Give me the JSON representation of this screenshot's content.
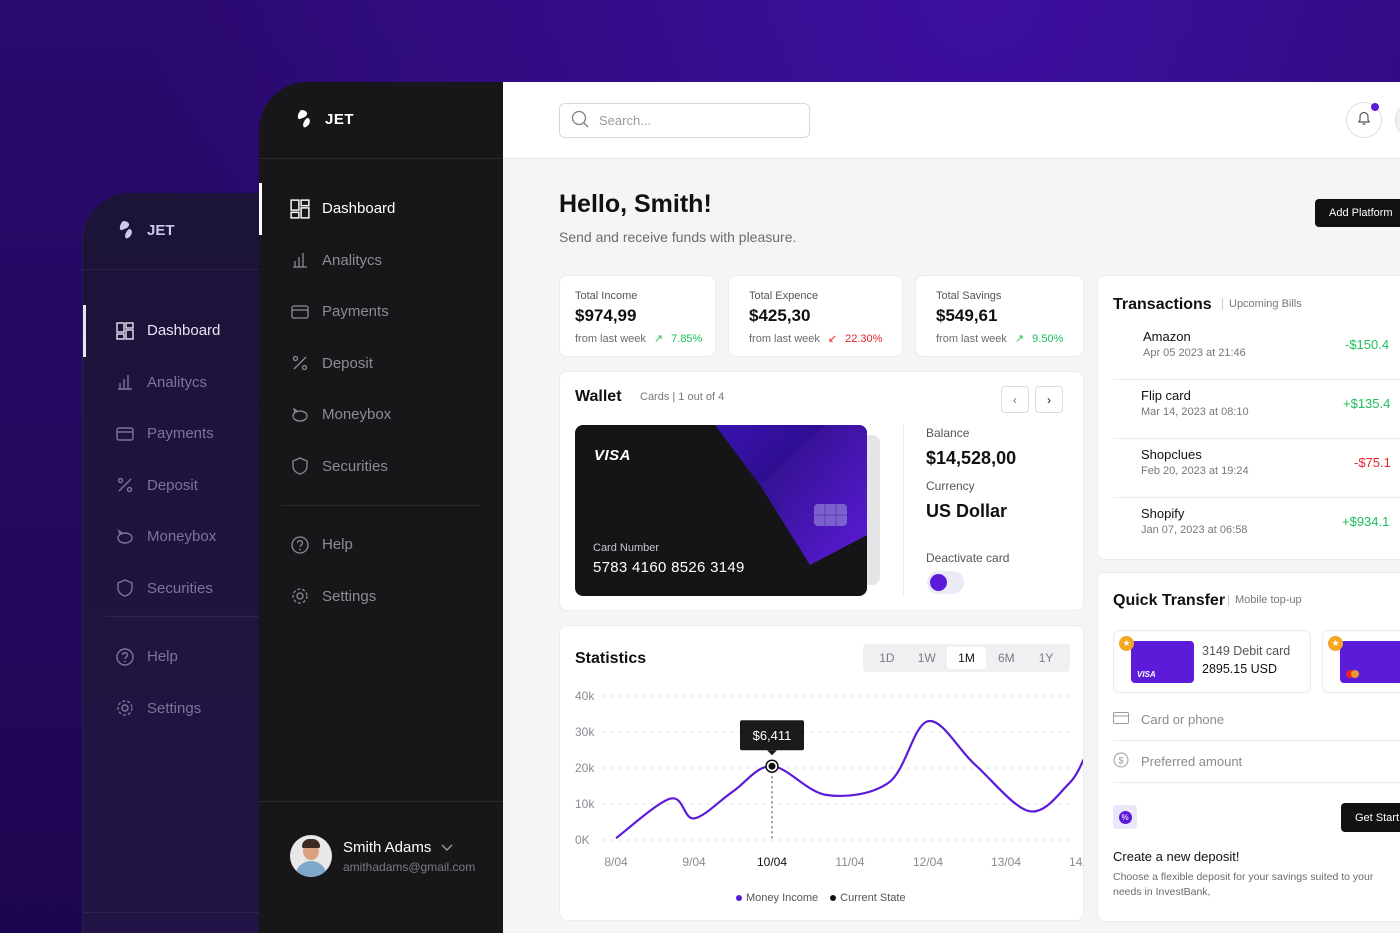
{
  "brand": {
    "name": "JET"
  },
  "sidebar": {
    "items": [
      {
        "label": "Dashboard",
        "icon": "dashboard-icon"
      },
      {
        "label": "Analitycs",
        "icon": "chart-icon"
      },
      {
        "label": "Payments",
        "icon": "wallet-icon"
      },
      {
        "label": "Deposit",
        "icon": "percent-icon"
      },
      {
        "label": "Moneybox",
        "icon": "piggy-bank-icon"
      },
      {
        "label": "Securities",
        "icon": "shield-icon"
      }
    ],
    "secondary": [
      {
        "label": "Help",
        "icon": "help-icon"
      },
      {
        "label": "Settings",
        "icon": "gear-icon"
      }
    ],
    "profile": {
      "name": "Smith Adams",
      "email": "amithadams@gmail.com"
    }
  },
  "topbar": {
    "search_placeholder": "Search..."
  },
  "header": {
    "greeting": "Hello, Smith!",
    "subtitle": "Send and receive funds with pleasure.",
    "add_button": "Add Platform"
  },
  "stats": [
    {
      "label": "Total Income",
      "value": "$974,99",
      "foot": "from last week",
      "change": "7.85%",
      "trend": "up"
    },
    {
      "label": "Total Expence",
      "value": "$425,30",
      "foot": "from last week",
      "change": "22.30%",
      "trend": "down"
    },
    {
      "label": "Total Savings",
      "value": "$549,61",
      "foot": "from last week",
      "change": "9.50%",
      "trend": "up"
    }
  ],
  "wallet": {
    "title": "Wallet",
    "cards_label": "Cards | 1 out of 4",
    "card_brand": "VISA",
    "card_number_label": "Card Number",
    "card_number": "5783 4160 8526 3149",
    "balance_label": "Balance",
    "balance": "$14,528,00",
    "currency_label": "Currency",
    "currency": "US Dollar",
    "deactivate_label": "Deactivate card"
  },
  "statistics": {
    "title": "Statistics",
    "periods": [
      "1D",
      "1W",
      "1M",
      "6M",
      "1Y"
    ],
    "active_period": "1M",
    "tooltip": "$6,411",
    "legend": [
      "Money Income",
      "Current State"
    ]
  },
  "chart_data": {
    "type": "line",
    "y_ticks": [
      "40k",
      "30k",
      "20k",
      "10k",
      "0K"
    ],
    "x_ticks": [
      "8/04",
      "9/04",
      "10/04",
      "11/04",
      "12/04",
      "13/04",
      "14/04"
    ],
    "ylim": [
      0,
      40000
    ],
    "grid": true,
    "series": [
      {
        "name": "Money Income",
        "x": [
          0,
          0.7,
          1.0,
          1.5,
          2.0,
          2.7,
          3.5,
          4.0,
          4.6,
          5.3,
          5.8,
          6.0
        ],
        "values": [
          500,
          11500,
          6000,
          13500,
          20500,
          12500,
          16000,
          33000,
          21000,
          8000,
          15500,
          22500
        ]
      }
    ],
    "highlight": {
      "x": "10/04",
      "value": 20500,
      "label": "$6,411"
    }
  },
  "transactions": {
    "title": "Transactions",
    "subtitle": "Upcoming Bills",
    "items": [
      {
        "name": "Amazon",
        "date": "Apr 05 2023 at 21:46",
        "amount": "-$150.4",
        "type": "down"
      },
      {
        "name": "Flip card",
        "date": "Mar 14, 2023 at 08:10",
        "amount": "+$135.4",
        "type": "up"
      },
      {
        "name": "Shopclues",
        "date": "Feb 20, 2023 at 19:24",
        "amount": "-$75.1",
        "type": "down"
      },
      {
        "name": "Shopify",
        "date": "Jan 07, 2023 at 06:58",
        "amount": "+$934.1",
        "type": "up"
      }
    ]
  },
  "quick_transfer": {
    "title": "Quick Transfer",
    "subtitle": "Mobile top-up",
    "card": {
      "title": "3149 Debit card",
      "amount": "2895.15 USD",
      "brand": "VISA"
    },
    "card_field": "Card or phone",
    "amount_field": "Preferred amount",
    "button": "Get Start",
    "heading": "Create a new deposit!",
    "desc": "Choose a flexible deposit for your savings suited to your needs in InvestBank,"
  },
  "colors": {
    "accent": "#5b1bd8",
    "up": "#1dbf5b",
    "down": "#e5252a"
  }
}
